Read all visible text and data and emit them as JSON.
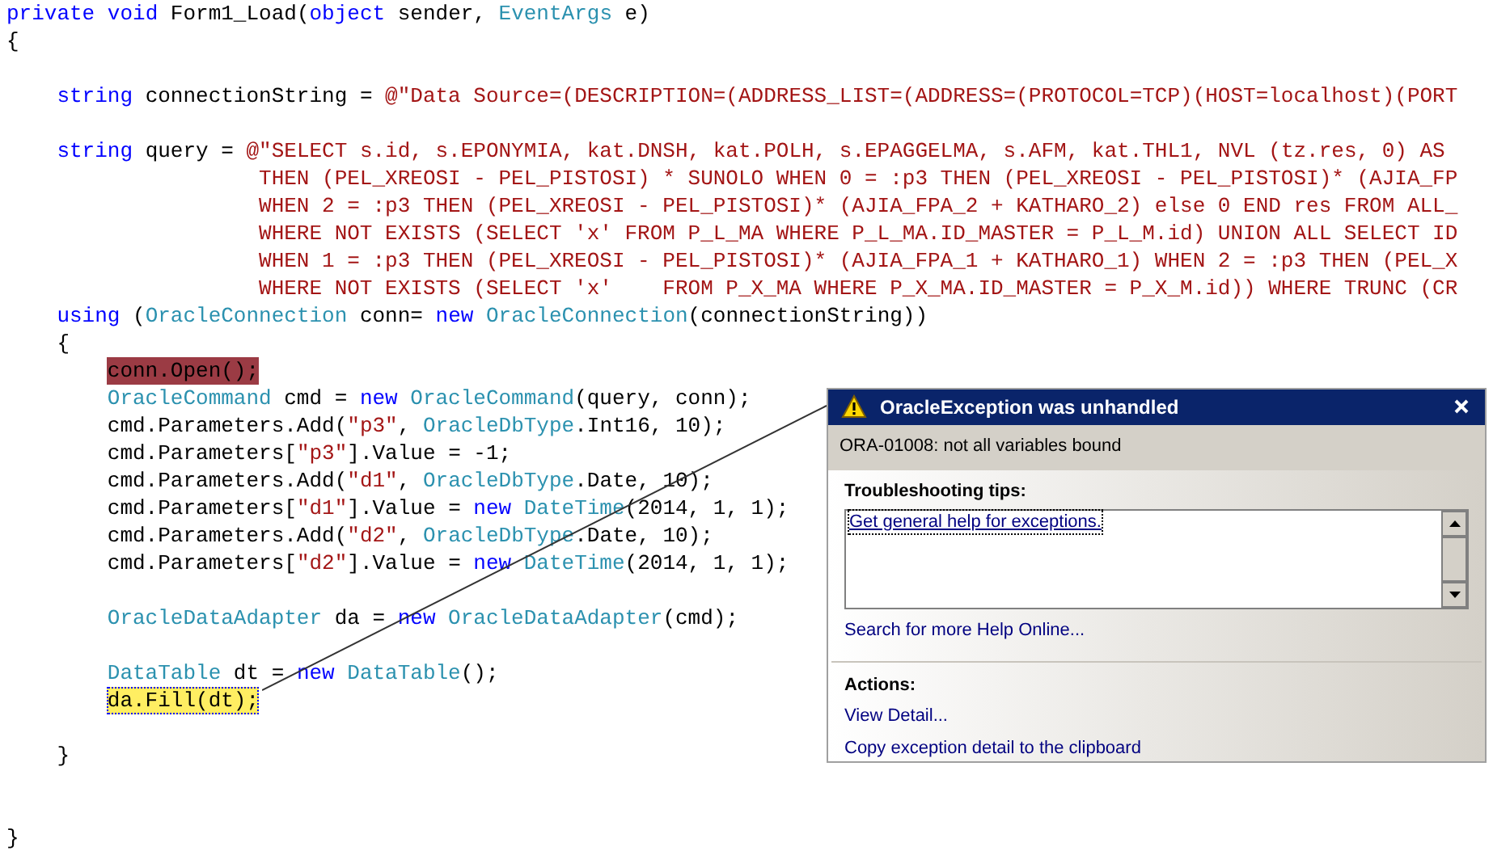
{
  "code_lines": [
    {
      "kind": "code",
      "tokens": [
        {
          "kind": "keyword",
          "text": "private"
        },
        {
          "kind": "keyword",
          "text": " void"
        },
        {
          "kind": "plain",
          "text": " Form1_Load("
        },
        {
          "kind": "keyword",
          "text": "object"
        },
        {
          "kind": "plain",
          "text": " sender, "
        },
        {
          "kind": "type",
          "text": "EventArgs"
        },
        {
          "kind": "plain",
          "text": " e)"
        }
      ]
    },
    {
      "kind": "code",
      "tokens": [
        {
          "kind": "plain",
          "text": "{"
        }
      ]
    },
    {
      "kind": "block",
      "children": [
        {
          "kind": "blank"
        },
        {
          "kind": "code",
          "tokens": [
            {
              "kind": "keyword",
              "text": "string"
            },
            {
              "kind": "plain",
              "text": " connectionString = "
            },
            {
              "kind": "string",
              "text": "@\"Data Source=(DESCRIPTION=(ADDRESS_LIST=(ADDRESS=(PROTOCOL=TCP)(HOST=localhost)(PORT"
            }
          ]
        },
        {
          "kind": "blank"
        },
        {
          "kind": "code",
          "tokens": [
            {
              "kind": "keyword",
              "text": "string"
            },
            {
              "kind": "plain",
              "text": " query = "
            },
            {
              "kind": "string",
              "text": "@\"SELECT s.id, s.EPONYMIA, kat.DNSH, kat.POLH, s.EPAGGELMA, s.AFM, kat.THL1, NVL (tz.res, 0) AS"
            }
          ]
        },
        {
          "kind": "code",
          "tokens": [
            {
              "kind": "string",
              "text": "                THEN (PEL_XREOSI - PEL_PISTOSI) * SUNOLO WHEN 0 = :p3 THEN (PEL_XREOSI - PEL_PISTOSI)* (AJIA_FP"
            }
          ]
        },
        {
          "kind": "code",
          "tokens": [
            {
              "kind": "string",
              "text": "                WHEN 2 = :p3 THEN (PEL_XREOSI - PEL_PISTOSI)* (AJIA_FPA_2 + KATHARO_2) else 0 END res FROM ALL_"
            }
          ]
        },
        {
          "kind": "code",
          "tokens": [
            {
              "kind": "string",
              "text": "                WHERE NOT EXISTS (SELECT 'x' FROM P_L_MA WHERE P_L_MA.ID_MASTER = P_L_M.id) UNION ALL SELECT ID"
            }
          ]
        },
        {
          "kind": "code",
          "tokens": [
            {
              "kind": "string",
              "text": "                WHEN 1 = :p3 THEN (PEL_XREOSI - PEL_PISTOSI)* (AJIA_FPA_1 + KATHARO_1) WHEN 2 = :p3 THEN (PEL_X"
            }
          ]
        },
        {
          "kind": "code",
          "tokens": [
            {
              "kind": "string",
              "text": "                WHERE NOT EXISTS (SELECT 'x'    FROM P_X_MA WHERE P_X_MA.ID_MASTER = P_X_M.id)) WHERE TRUNC (CR"
            }
          ]
        },
        {
          "kind": "code",
          "tokens": [
            {
              "kind": "keyword",
              "text": "using"
            },
            {
              "kind": "plain",
              "text": " ("
            },
            {
              "kind": "type",
              "text": "OracleConnection"
            },
            {
              "kind": "plain",
              "text": " conn= "
            },
            {
              "kind": "keyword",
              "text": "new"
            },
            {
              "kind": "type",
              "text": " OracleConnection"
            },
            {
              "kind": "plain",
              "text": "(connectionString))"
            }
          ]
        },
        {
          "kind": "code",
          "tokens": [
            {
              "kind": "plain",
              "text": "{"
            }
          ]
        },
        {
          "kind": "block",
          "children": [
            {
              "kind": "error_statement",
              "tokens": [
                {
                  "kind": "plain",
                  "text": "conn.Open();"
                }
              ]
            },
            {
              "kind": "code",
              "tokens": [
                {
                  "kind": "type",
                  "text": "OracleCommand"
                },
                {
                  "kind": "plain",
                  "text": " cmd = "
                },
                {
                  "kind": "keyword",
                  "text": "new"
                },
                {
                  "kind": "type",
                  "text": " OracleCommand"
                },
                {
                  "kind": "plain",
                  "text": "(query, conn);"
                }
              ]
            },
            {
              "kind": "code",
              "tokens": [
                {
                  "kind": "plain",
                  "text": "cmd.Parameters.Add("
                },
                {
                  "kind": "string",
                  "text": "\"p3\""
                },
                {
                  "kind": "plain",
                  "text": ", "
                },
                {
                  "kind": "type",
                  "text": "OracleDbType"
                },
                {
                  "kind": "plain",
                  "text": ".Int16, 10);"
                }
              ]
            },
            {
              "kind": "code",
              "tokens": [
                {
                  "kind": "plain",
                  "text": "cmd.Parameters["
                },
                {
                  "kind": "string",
                  "text": "\"p3\""
                },
                {
                  "kind": "plain",
                  "text": "].Value = -1;"
                }
              ]
            },
            {
              "kind": "code",
              "tokens": [
                {
                  "kind": "plain",
                  "text": "cmd.Parameters.Add("
                },
                {
                  "kind": "string",
                  "text": "\"d1\""
                },
                {
                  "kind": "plain",
                  "text": ", "
                },
                {
                  "kind": "type",
                  "text": "OracleDbType"
                },
                {
                  "kind": "plain",
                  "text": ".Date, 10);"
                }
              ]
            },
            {
              "kind": "code",
              "tokens": [
                {
                  "kind": "plain",
                  "text": "cmd.Parameters["
                },
                {
                  "kind": "string",
                  "text": "\"d1\""
                },
                {
                  "kind": "plain",
                  "text": "].Value = "
                },
                {
                  "kind": "keyword",
                  "text": "new"
                },
                {
                  "kind": "type",
                  "text": " DateTime"
                },
                {
                  "kind": "plain",
                  "text": "(2014, 1, 1);"
                }
              ]
            },
            {
              "kind": "code",
              "tokens": [
                {
                  "kind": "plain",
                  "text": "cmd.Parameters.Add("
                },
                {
                  "kind": "string",
                  "text": "\"d2\""
                },
                {
                  "kind": "plain",
                  "text": ", "
                },
                {
                  "kind": "type",
                  "text": "OracleDbType"
                },
                {
                  "kind": "plain",
                  "text": ".Date, 10);"
                }
              ]
            },
            {
              "kind": "code",
              "tokens": [
                {
                  "kind": "plain",
                  "text": "cmd.Parameters["
                },
                {
                  "kind": "string",
                  "text": "\"d2\""
                },
                {
                  "kind": "plain",
                  "text": "].Value = "
                },
                {
                  "kind": "keyword",
                  "text": "new"
                },
                {
                  "kind": "type",
                  "text": " DateTime"
                },
                {
                  "kind": "plain",
                  "text": "(2014, 1, 1);"
                }
              ]
            },
            {
              "kind": "blank"
            },
            {
              "kind": "code",
              "tokens": [
                {
                  "kind": "type",
                  "text": "OracleDataAdapter"
                },
                {
                  "kind": "plain",
                  "text": " da = "
                },
                {
                  "kind": "keyword",
                  "text": "new"
                },
                {
                  "kind": "type",
                  "text": " OracleDataAdapter"
                },
                {
                  "kind": "plain",
                  "text": "(cmd);"
                }
              ]
            },
            {
              "kind": "blank"
            },
            {
              "kind": "code",
              "tokens": [
                {
                  "kind": "type",
                  "text": "DataTable"
                },
                {
                  "kind": "plain",
                  "text": " dt = "
                },
                {
                  "kind": "keyword",
                  "text": "new"
                },
                {
                  "kind": "type",
                  "text": " DataTable"
                },
                {
                  "kind": "plain",
                  "text": "();"
                }
              ]
            },
            {
              "kind": "current_statement",
              "tokens": [
                {
                  "kind": "plain",
                  "text": "da.Fill(dt);"
                }
              ]
            },
            {
              "kind": "blank"
            }
          ]
        },
        {
          "kind": "code",
          "tokens": [
            {
              "kind": "plain",
              "text": "}"
            }
          ]
        }
      ]
    },
    {
      "kind": "blank"
    },
    {
      "kind": "blank"
    },
    {
      "kind": "code",
      "tokens": [
        {
          "kind": "plain",
          "text": "}"
        }
      ]
    }
  ],
  "exception_dialog": {
    "title": "OracleException was unhandled",
    "message": "ORA-01008: not all variables bound",
    "tips_heading": "Troubleshooting tips:",
    "tips": [
      "Get general help for exceptions."
    ],
    "search_link": "Search for more Help Online...",
    "actions_heading": "Actions:",
    "actions": [
      "View Detail...",
      "Copy exception detail to the clipboard"
    ]
  }
}
